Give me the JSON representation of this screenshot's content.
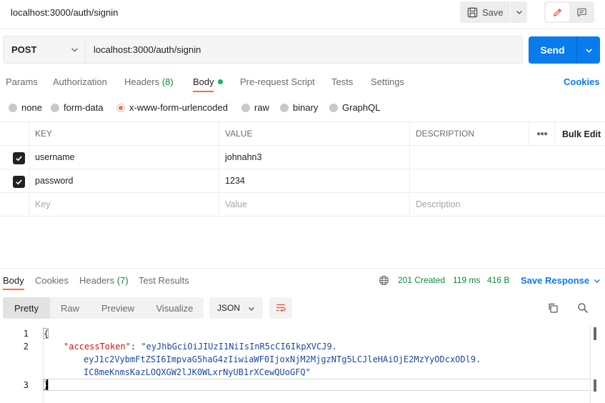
{
  "request": {
    "title": "localhost:3000/auth/signin",
    "save_label": "Save",
    "method": "POST",
    "url": "localhost:3000/auth/signin",
    "send_label": "Send"
  },
  "request_tabs": [
    {
      "label": "Params",
      "count": ""
    },
    {
      "label": "Authorization",
      "count": ""
    },
    {
      "label": "Headers",
      "count": "(8)"
    },
    {
      "label": "Body",
      "count": ""
    },
    {
      "label": "Pre-request Script",
      "count": ""
    },
    {
      "label": "Tests",
      "count": ""
    },
    {
      "label": "Settings",
      "count": ""
    }
  ],
  "cookies_label": "Cookies",
  "body_types": [
    "none",
    "form-data",
    "x-www-form-urlencoded",
    "raw",
    "binary",
    "GraphQL"
  ],
  "body_type_selected": "x-www-form-urlencoded",
  "params_table": {
    "headers": {
      "key": "KEY",
      "value": "VALUE",
      "description": "DESCRIPTION",
      "bulk": "Bulk Edit"
    },
    "rows": [
      {
        "key": "username",
        "value": "johnahn3",
        "description": "",
        "checked": true
      },
      {
        "key": "password",
        "value": "1234",
        "description": "",
        "checked": true
      }
    ],
    "placeholder": {
      "key": "Key",
      "value": "Value",
      "description": "Description"
    }
  },
  "response": {
    "tabs": [
      {
        "label": "Body",
        "count": ""
      },
      {
        "label": "Cookies",
        "count": ""
      },
      {
        "label": "Headers",
        "count": "(7)"
      },
      {
        "label": "Test Results",
        "count": ""
      }
    ],
    "status": "201 Created",
    "time": "119 ms",
    "size": "416 B",
    "save_label": "Save Response",
    "formats": [
      "Pretty",
      "Raw",
      "Preview",
      "Visualize"
    ],
    "language": "JSON",
    "code": {
      "line1": "{",
      "key": "\"accessToken\"",
      "colon": ": ",
      "token_part1": "\"eyJhbGciOiJIUzI1NiIsInR5cCI6IkpXVCJ9.",
      "token_part2": "eyJ1c2VybmFtZSI6ImpvaG5haG4zIiwiaWF0IjoxNjM2MjgzNTg5LCJleHAiOjE2MzYyODcxODl9.",
      "token_part3": "IC8meKnmsKazLOQXGW2lJK0WLxrNyUB1rXCewQUoGFQ\"",
      "line3": "}",
      "line_numbers": [
        "1",
        "2",
        "3"
      ]
    }
  },
  "colors": {
    "accent": "#097bed",
    "active_tab": "#ff6c37",
    "status_ok": "#0a8a3a"
  }
}
